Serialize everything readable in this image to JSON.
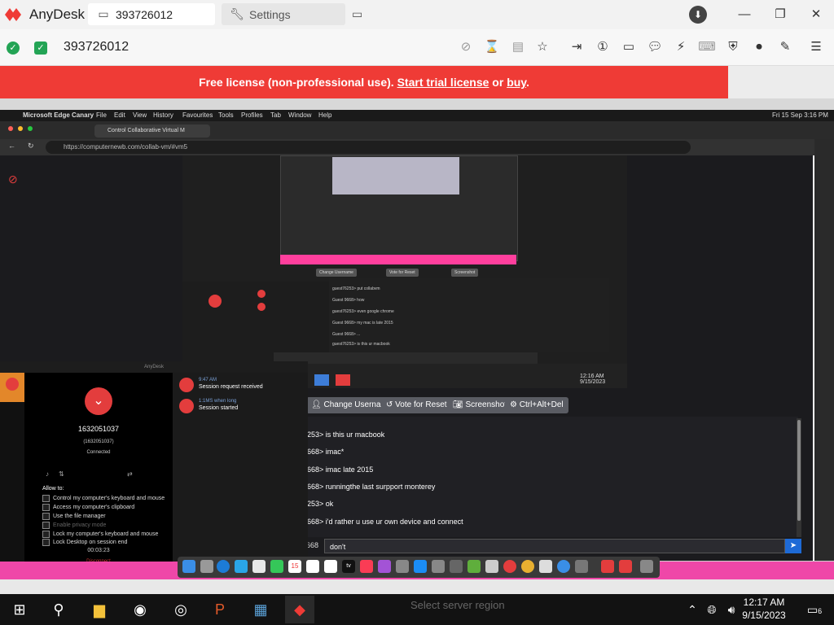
{
  "app": {
    "brand": "AnyDesk",
    "tabs": [
      {
        "label": "393726012",
        "icon": "monitor-icon"
      },
      {
        "label": "Settings",
        "icon": "wrench-icon"
      }
    ],
    "window_controls": [
      "minimize",
      "restore",
      "close"
    ]
  },
  "toolbar": {
    "session_id": "393726012"
  },
  "banner": {
    "prefix": "Free license (non-professional use). ",
    "trial_link": "Start trial license",
    "middle": " or ",
    "buy_link": "buy",
    "suffix": "."
  },
  "remote": {
    "mac_menu": [
      "Microsoft Edge Canary",
      "File",
      "Edit",
      "View",
      "History",
      "Favourites",
      "Tools",
      "Profiles",
      "Tab",
      "Window",
      "Help"
    ],
    "mac_clock": "Fri 15 Sep  3:16 PM",
    "browser_tab": "Control Collaborative Virtual M",
    "url": "https://computernewb.com/collab-vm/#vm5",
    "inner_time": "12:16 AM",
    "inner_date": "9/15/2023",
    "inner_chat": [
      "guest76253> put collabvm",
      "Guest 9668> how",
      "guest76253> even google chrome",
      "Guest 9668> my mac is late 2015",
      "Guest 9668> ...",
      "guest76253> is this ur macbook"
    ],
    "control_buttons": [
      "Change Username",
      "Vote for Reset",
      "Screenshot",
      "Ctrl+Alt+Del"
    ],
    "chat": [
      "253> is this ur macbook",
      "668> imac*",
      "668> imac late 2015",
      "668> runningthe last surpport monterey",
      "253> ok",
      "668> i'd rather u use ur own device and connect"
    ],
    "chat_prefix": "668",
    "chat_input_value": "don't"
  },
  "anydesk_panel": {
    "title": "AnyDesk",
    "id": "1632051037",
    "id_sub": "(1632051037)",
    "status": "Connected",
    "allow_title": "Allow to:",
    "permissions": [
      {
        "label": "Control my computer's keyboard and mouse",
        "enabled": true
      },
      {
        "label": "Access my computer's clipboard",
        "enabled": true
      },
      {
        "label": "Use the file manager",
        "enabled": true
      },
      {
        "label": "Enable privacy mode",
        "enabled": false
      },
      {
        "label": "Lock my computer's keyboard and mouse",
        "enabled": true
      },
      {
        "label": "Lock Desktop on session end",
        "enabled": true
      }
    ],
    "timer": "00:03:23",
    "disconnect": "Disconnect",
    "notifications": [
      {
        "title": "9:47 AM",
        "text": "Session request received"
      },
      {
        "title": "1:1MS when long",
        "text": "Session started"
      }
    ]
  },
  "taskbar": {
    "time": "12:17 AM",
    "date": "9/15/2023",
    "notification_count": "6",
    "ghost_text": "Select server region"
  },
  "colors": {
    "banner": "#ef3b36",
    "accent_red": "#e33d3d",
    "check_green": "#23a455",
    "dock_pink": "#ef47a8"
  }
}
